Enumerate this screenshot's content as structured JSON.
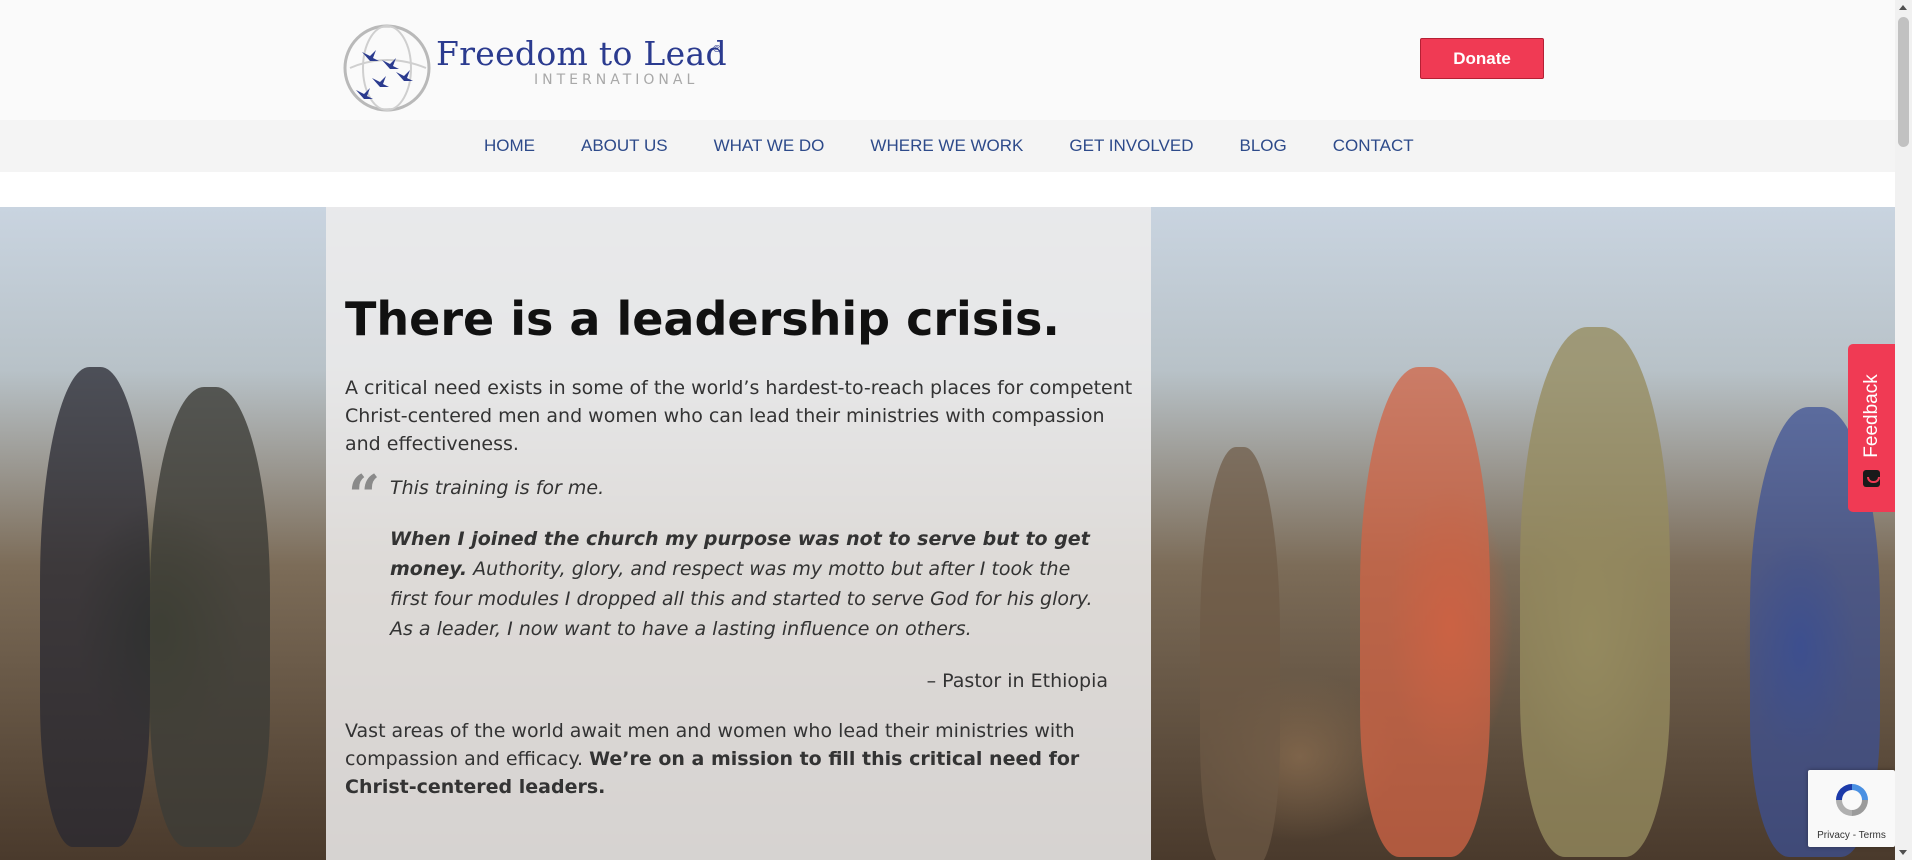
{
  "header": {
    "logo": {
      "name": "Freedom to Lead",
      "registered": "®",
      "subtitle": "INTERNATIONAL",
      "brand_color": "#2b3b8f"
    },
    "donate_label": "Donate",
    "donate_color": "#f03a54"
  },
  "nav": {
    "items": [
      {
        "label": "HOME"
      },
      {
        "label": "ABOUT US"
      },
      {
        "label": "WHAT WE DO"
      },
      {
        "label": "WHERE WE WORK"
      },
      {
        "label": "GET INVOLVED"
      },
      {
        "label": "BLOG"
      },
      {
        "label": "CONTACT"
      }
    ]
  },
  "hero": {
    "title": "There is a leadership crisis.",
    "intro": "A critical need exists in some of the world’s hardest-to-reach places for competent Christ-centered men and women who can lead their ministries with compassion and effectiveness.",
    "quote_icon": "quote-icon",
    "quote": {
      "lead": "This training is for me.",
      "bold": "When I joined the church my purpose was not to serve but to get money.",
      "rest": " Authority, glory, and respect was my motto but after I took the first four modules I dropped all this and started to serve God for his glory. As a leader, I now want to have a lasting influence on others."
    },
    "attribution": "– Pastor in Ethiopia",
    "outro": "Vast areas of the world await men and women who lead their ministries with compassion and efficacy. ",
    "outro_bold": "We’re on a mission to fill this critical need for Christ-centered leaders."
  },
  "feedback": {
    "label": "Feedback",
    "icon": "feedback-icon"
  },
  "recaptcha": {
    "links": "Privacy - Terms",
    "icon": "recaptcha-icon"
  }
}
